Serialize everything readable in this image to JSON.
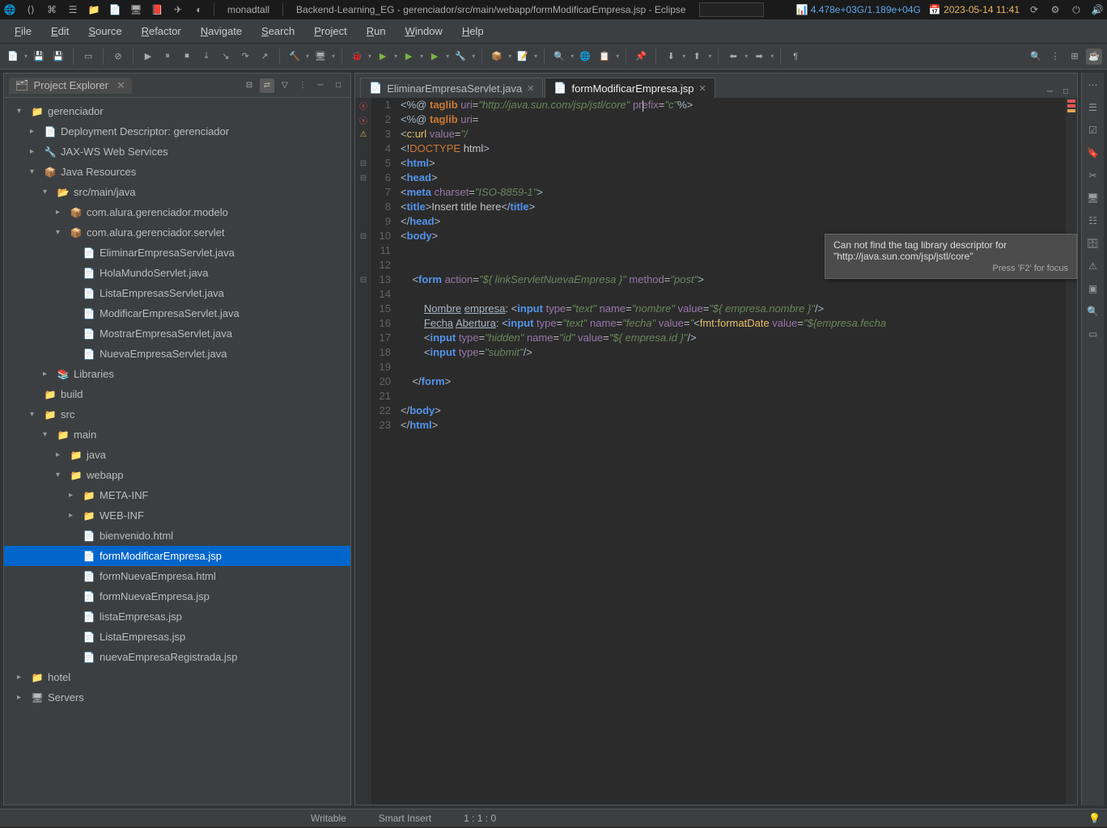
{
  "topbar": {
    "monad": "monadtall",
    "window_title": "Backend-Learning_EG - gerenciador/src/main/webapp/formModificarEmpresa.jsp - Eclipse",
    "mem": "4.478e+03G/1.189e+04G",
    "date": "2023-05-14 11:41"
  },
  "menubar": [
    "File",
    "Edit",
    "Source",
    "Refactor",
    "Navigate",
    "Search",
    "Project",
    "Run",
    "Window",
    "Help"
  ],
  "project_explorer": {
    "title": "Project Explorer"
  },
  "tree": [
    {
      "indent": 16,
      "chev": "▾",
      "icon": "📁",
      "label": "gerenciador"
    },
    {
      "indent": 32,
      "chev": "▸",
      "icon": "📄",
      "label": "Deployment Descriptor: gerenciador"
    },
    {
      "indent": 32,
      "chev": "▸",
      "icon": "🔧",
      "label": "JAX-WS Web Services"
    },
    {
      "indent": 32,
      "chev": "▾",
      "icon": "📦",
      "label": "Java Resources"
    },
    {
      "indent": 48,
      "chev": "▾",
      "icon": "📂",
      "label": "src/main/java"
    },
    {
      "indent": 64,
      "chev": "▸",
      "icon": "📦",
      "label": "com.alura.gerenciador.modelo"
    },
    {
      "indent": 64,
      "chev": "▾",
      "icon": "📦",
      "label": "com.alura.gerenciador.servlet"
    },
    {
      "indent": 80,
      "chev": "",
      "icon": "📄",
      "label": "EliminarEmpresaServlet.java"
    },
    {
      "indent": 80,
      "chev": "",
      "icon": "📄",
      "label": "HolaMundoServlet.java"
    },
    {
      "indent": 80,
      "chev": "",
      "icon": "📄",
      "label": "ListaEmpresasServlet.java"
    },
    {
      "indent": 80,
      "chev": "",
      "icon": "📄",
      "label": "ModificarEmpresaServlet.java"
    },
    {
      "indent": 80,
      "chev": "",
      "icon": "📄",
      "label": "MostrarEmpresaServlet.java"
    },
    {
      "indent": 80,
      "chev": "",
      "icon": "📄",
      "label": "NuevaEmpresaServlet.java"
    },
    {
      "indent": 48,
      "chev": "▸",
      "icon": "📚",
      "label": "Libraries"
    },
    {
      "indent": 32,
      "chev": "",
      "icon": "📁",
      "label": "build"
    },
    {
      "indent": 32,
      "chev": "▾",
      "icon": "📁",
      "label": "src"
    },
    {
      "indent": 48,
      "chev": "▾",
      "icon": "📁",
      "label": "main"
    },
    {
      "indent": 64,
      "chev": "▸",
      "icon": "📁",
      "label": "java"
    },
    {
      "indent": 64,
      "chev": "▾",
      "icon": "📁",
      "label": "webapp"
    },
    {
      "indent": 80,
      "chev": "▸",
      "icon": "📁",
      "label": "META-INF"
    },
    {
      "indent": 80,
      "chev": "▸",
      "icon": "📁",
      "label": "WEB-INF"
    },
    {
      "indent": 80,
      "chev": "",
      "icon": "📄",
      "label": "bienvenido.html"
    },
    {
      "indent": 80,
      "chev": "",
      "icon": "📄",
      "label": "formModificarEmpresa.jsp",
      "selected": true
    },
    {
      "indent": 80,
      "chev": "",
      "icon": "📄",
      "label": "formNuevaEmpresa.html"
    },
    {
      "indent": 80,
      "chev": "",
      "icon": "📄",
      "label": "formNuevaEmpresa.jsp"
    },
    {
      "indent": 80,
      "chev": "",
      "icon": "📄",
      "label": "listaEmpresas.jsp"
    },
    {
      "indent": 80,
      "chev": "",
      "icon": "📄",
      "label": "ListaEmpresas.jsp"
    },
    {
      "indent": 80,
      "chev": "",
      "icon": "📄",
      "label": "nuevaEmpresaRegistrada.jsp"
    },
    {
      "indent": 16,
      "chev": "▸",
      "icon": "📁",
      "label": "hotel"
    },
    {
      "indent": 16,
      "chev": "▸",
      "icon": "🖥",
      "label": "Servers"
    }
  ],
  "tabs": [
    {
      "icon": "📄",
      "label": "EliminarEmpresaServlet.java",
      "active": false
    },
    {
      "icon": "📄",
      "label": "formModificarEmpresa.jsp",
      "active": true
    }
  ],
  "tooltip": {
    "msg": "Can not find the tag library descriptor for \"http://java.sun.com/jsp/jstl/core\"",
    "sub": "Press 'F2' for focus"
  },
  "code_plain": [
    "<%@ taglib uri=\"http://java.sun.com/jsp/jstl/core\" prefix=\"c\"%>",
    "<%@ taglib uri=",
    "<c:url value=\"/",
    "<!DOCTYPE html>",
    "<html>",
    "<head>",
    "<meta charset=\"ISO-8859-1\">",
    "<title>Insert title here</title>",
    "</head>",
    "<body>",
    "",
    "",
    "    <form action=\"${ linkServletNuevaEmpresa }\" method=\"post\">",
    "",
    "        Nombre empresa: <input type=\"text\" name=\"nombre\" value=\"${ empresa.nombre }\"/>",
    "        Fecha Abertura: <input type=\"text\" name=\"fecha\" value=\"<fmt:formatDate value=\"${empresa.fecha",
    "        <input type=\"hidden\" name=\"id\" value=\"${ empresa.id }\"/>",
    "        <input type=\"submit\"/>",
    "",
    "    </form>",
    "",
    "</body>",
    "</html>"
  ],
  "statusbar": {
    "writable": "Writable",
    "insert": "Smart Insert",
    "pos": "1 : 1 : 0"
  }
}
